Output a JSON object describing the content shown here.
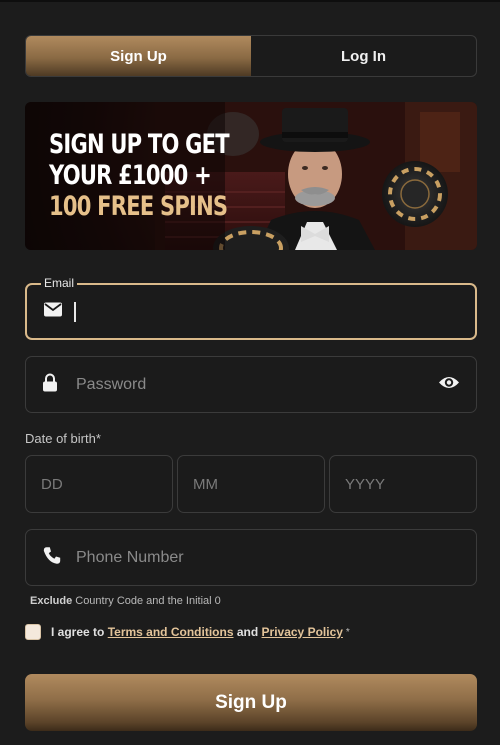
{
  "tabs": [
    {
      "label": "Sign Up",
      "active": true
    },
    {
      "label": "Log In",
      "active": false
    }
  ],
  "banner": {
    "lines": [
      "SIGN UP TO GET",
      "YOUR £1000 +",
      "100 FREE SPINS"
    ]
  },
  "email": {
    "label": "Email",
    "value": "",
    "icon": "envelope-icon"
  },
  "password": {
    "placeholder": "Password",
    "icon": "lock-icon",
    "toggle_icon": "eye-icon"
  },
  "dob": {
    "label": "Date of birth*",
    "day_placeholder": "DD",
    "month_placeholder": "MM",
    "year_placeholder": "YYYY"
  },
  "phone": {
    "placeholder": "Phone Number",
    "icon": "phone-icon",
    "hint_bold": "Exclude",
    "hint_rest": " Country Code and the Initial 0"
  },
  "agreement": {
    "prefix": "I agree to",
    "terms_link": "Terms and Conditions",
    "and": "and",
    "privacy_link": "Privacy Policy",
    "required_mark": "*"
  },
  "submit_label": "Sign Up",
  "colors": {
    "accent": "#d9b98a",
    "button_top": "#b08a5e",
    "button_bottom": "#3c2b19",
    "background": "#1c1c1c"
  }
}
